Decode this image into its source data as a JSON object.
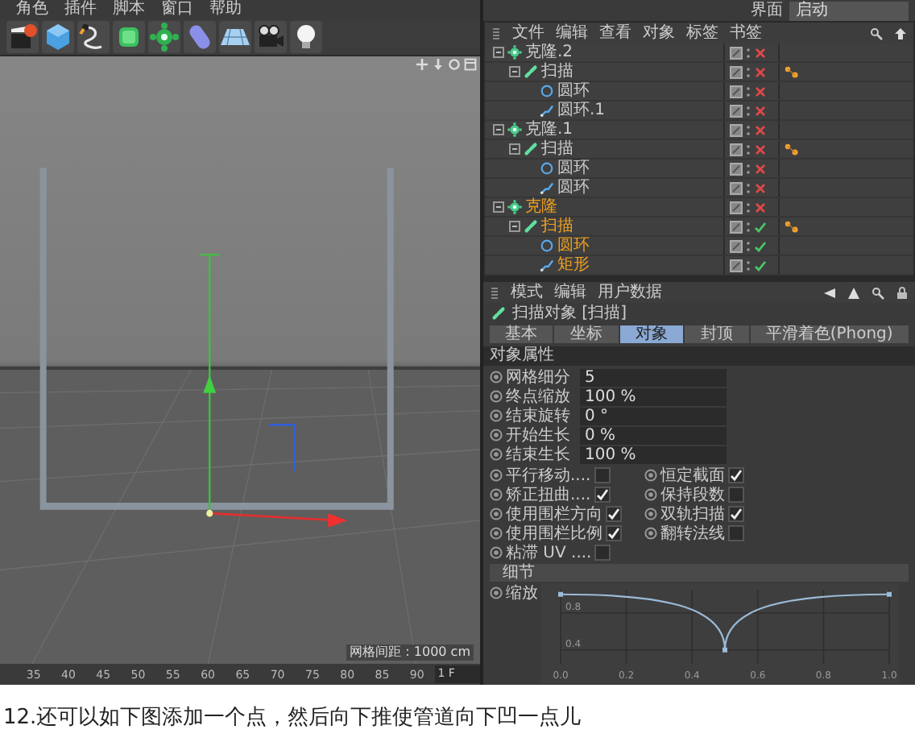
{
  "menu_bar": {
    "items": [
      "角色",
      "插件",
      "脚本",
      "窗口",
      "帮助"
    ]
  },
  "layout_selector": {
    "label": "界面",
    "value": "启动"
  },
  "toolbar": {
    "tools": [
      {
        "kind": "clapper"
      },
      {
        "kind": "cube"
      },
      {
        "kind": "pen"
      },
      {
        "kind": "subdivision"
      },
      {
        "kind": "cloner"
      },
      {
        "kind": "capsule"
      },
      {
        "kind": "floor"
      },
      {
        "kind": "camera"
      },
      {
        "kind": "light"
      }
    ]
  },
  "viewport": {
    "grid_spacing": "网格间距 : 1000 cm"
  },
  "timeline": {
    "ticks": [
      "35",
      "40",
      "45",
      "50",
      "55",
      "60",
      "65",
      "70",
      "75",
      "80",
      "85",
      "90"
    ],
    "frame": "1 F"
  },
  "object_manager": {
    "menu": [
      "文件",
      "编辑",
      "查看",
      "对象",
      "标签",
      "书签"
    ],
    "objects": [
      {
        "name": "克隆.2",
        "kind": "cloner",
        "enabled": false,
        "selected": false,
        "expanded": true,
        "children": [
          {
            "name": "扫描",
            "kind": "sweep",
            "enabled": false,
            "selected": false,
            "expanded": true,
            "children": [
              {
                "name": "圆环",
                "kind": "circle",
                "enabled": false,
                "selected": false
              },
              {
                "name": "圆环.1",
                "kind": "spline",
                "enabled": false,
                "selected": false
              }
            ]
          }
        ]
      },
      {
        "name": "克隆.1",
        "kind": "cloner",
        "enabled": false,
        "selected": false,
        "expanded": true,
        "children": [
          {
            "name": "扫描",
            "kind": "sweep",
            "enabled": false,
            "selected": false,
            "expanded": true,
            "children": [
              {
                "name": "圆环",
                "kind": "circle",
                "enabled": false,
                "selected": false
              },
              {
                "name": "圆环",
                "kind": "spline",
                "enabled": false,
                "selected": false
              }
            ]
          }
        ]
      },
      {
        "name": "克隆",
        "kind": "cloner",
        "enabled": false,
        "selected": true,
        "expanded": true,
        "children": [
          {
            "name": "扫描",
            "kind": "sweep",
            "enabled": true,
            "selected": true,
            "expanded": true,
            "children": [
              {
                "name": "圆环",
                "kind": "circle",
                "enabled": true,
                "selected": true
              },
              {
                "name": "矩形",
                "kind": "spline",
                "enabled": true,
                "selected": true
              }
            ]
          }
        ]
      }
    ]
  },
  "attributes": {
    "menu": [
      "模式",
      "编辑",
      "用户数据"
    ],
    "object_title": "扫描对象 [扫描]",
    "tabs": [
      {
        "label": "基本",
        "selected": false
      },
      {
        "label": "坐标",
        "selected": false
      },
      {
        "label": "对象",
        "selected": true
      },
      {
        "label": "封顶",
        "selected": false
      },
      {
        "label": "平滑着色(Phong)",
        "selected": false
      }
    ],
    "section": "对象属性",
    "fields": [
      {
        "label": "网格细分",
        "value": "5"
      },
      {
        "label": "终点缩放",
        "value": "100 %"
      },
      {
        "label": "结束旋转",
        "value": "0 °"
      },
      {
        "label": "开始生长",
        "value": "0 %"
      },
      {
        "label": "结束生长",
        "value": "100 %"
      }
    ],
    "options": [
      {
        "label": "平行移动....",
        "checked": false
      },
      {
        "label": "恒定截面",
        "checked": true
      },
      {
        "label": "矫正扭曲....",
        "checked": true
      },
      {
        "label": "保持段数",
        "checked": false
      },
      {
        "label": "使用围栏方向",
        "checked": true
      },
      {
        "label": "双轨扫描",
        "checked": true
      },
      {
        "label": "使用围栏比例",
        "checked": true
      },
      {
        "label": "翻转法线",
        "checked": false
      },
      {
        "label": "粘滞 UV ....",
        "checked": false
      }
    ],
    "detail_section": "细节",
    "chart_data": {
      "type": "line",
      "grid": true,
      "x": [
        0,
        0.5,
        1
      ],
      "series": [
        {
          "name": "缩放",
          "color": "#9bbbd8",
          "marker": "square",
          "values": [
            1,
            0.4,
            1
          ]
        }
      ],
      "xlim": [
        0,
        1
      ],
      "ylim": [
        0.25,
        1.05
      ],
      "xticks": [
        {
          "value": 0,
          "label": "0.0"
        },
        {
          "value": 0.2,
          "label": "0.2"
        },
        {
          "value": 0.4,
          "label": "0.4"
        },
        {
          "value": 0.6,
          "label": "0.6"
        },
        {
          "value": 0.8,
          "label": "0.8"
        },
        {
          "value": 1,
          "label": "1.0"
        }
      ],
      "yticks": [
        {
          "value": 0.4,
          "label": "0.4"
        },
        {
          "value": 0.8,
          "label": "0.8"
        }
      ]
    }
  },
  "caption": "12.还可以如下图添加一个点，然后向下推使管道向下凹一点儿"
}
